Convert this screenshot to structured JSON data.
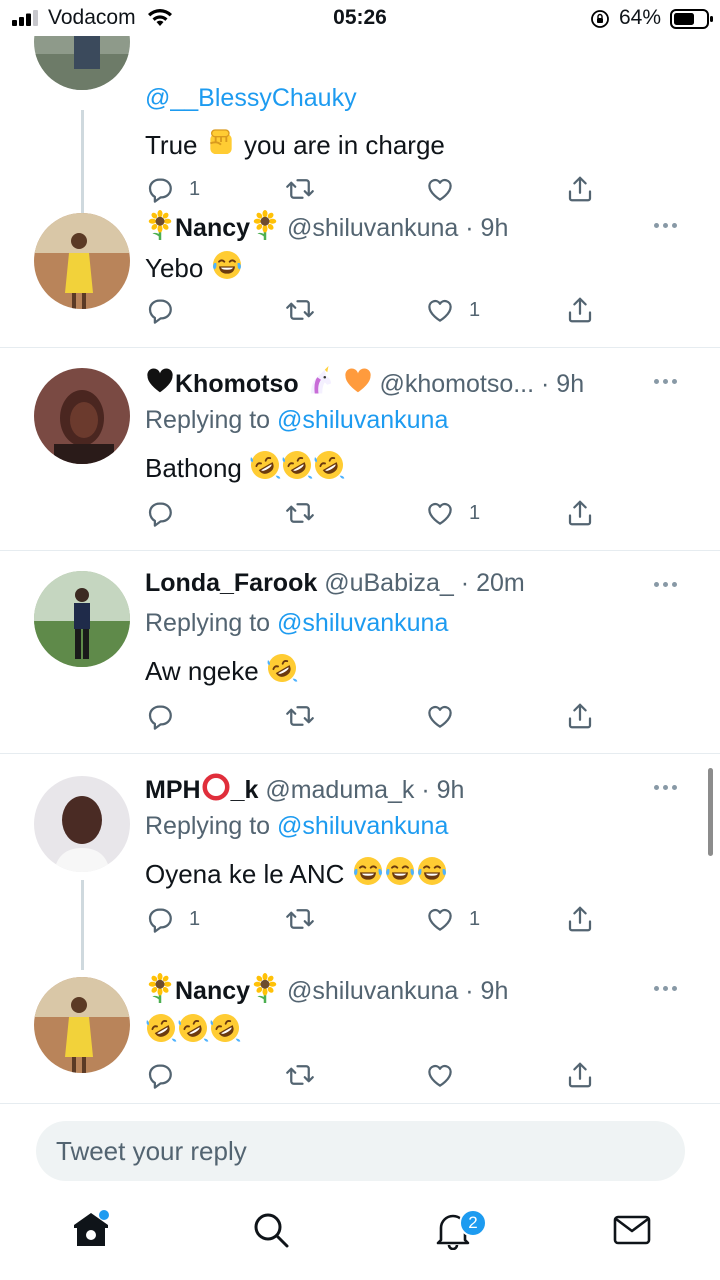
{
  "status_bar": {
    "carrier": "Vodacom",
    "time": "05:26",
    "battery": "64%"
  },
  "tweets": [
    {
      "reply_to": "@__BlessyChauky",
      "text": "True",
      "text_after": "you are in charge",
      "text_emoji": "raised-fist",
      "reply_count": "1",
      "retweet_count": "",
      "like_count": ""
    },
    {
      "name": "Nancy",
      "name_emoji": "sunflower",
      "handle": "@shiluvankuna",
      "time": "· 9h",
      "text": "Yebo",
      "text_emojis": [
        "face-with-tears-of-joy"
      ],
      "reply_count": "",
      "retweet_count": "",
      "like_count": "1"
    },
    {
      "name": "Khomotso",
      "name_emojis": [
        "black-heart",
        "unicorn",
        "orange-heart"
      ],
      "handle": "@khomotso...",
      "time": "· 9h",
      "reply_label": "Replying to",
      "reply_to": "@shiluvankuna",
      "text": "Bathong",
      "text_emojis": [
        "rolling-on-floor-laughing",
        "rolling-on-floor-laughing",
        "rolling-on-floor-laughing"
      ],
      "reply_count": "",
      "retweet_count": "",
      "like_count": "1"
    },
    {
      "name": "Londa_Farook",
      "handle": "@uBabiza_",
      "time": "· 20m",
      "reply_label": "Replying to",
      "reply_to": "@shiluvankuna",
      "text": "Aw ngeke",
      "text_emojis": [
        "rolling-on-floor-laughing"
      ],
      "reply_count": "",
      "retweet_count": "",
      "like_count": ""
    },
    {
      "name_prefix": "MPH",
      "name_suffix": "_k",
      "name_emoji": "hollow-red-circle",
      "handle": "@maduma_k",
      "time": "· 9h",
      "reply_label": "Replying to",
      "reply_to": "@shiluvankuna",
      "text": "Oyena ke le ANC",
      "text_emojis": [
        "face-with-tears-of-joy",
        "face-with-tears-of-joy",
        "face-with-tears-of-joy"
      ],
      "reply_count": "1",
      "retweet_count": "",
      "like_count": "1"
    },
    {
      "name": "Nancy",
      "name_emoji": "sunflower",
      "handle": "@shiluvankuna",
      "time": "· 9h",
      "text_emojis": [
        "rolling-on-floor-laughing",
        "rolling-on-floor-laughing",
        "rolling-on-floor-laughing"
      ],
      "reply_count": "",
      "retweet_count": "",
      "like_count": ""
    }
  ],
  "reply_box": {
    "placeholder": "Tweet your reply"
  },
  "nav": {
    "notification_badge": "2",
    "items": [
      "home-icon",
      "search-icon",
      "notifications-icon",
      "messages-icon"
    ]
  },
  "colors": {
    "accent": "#1d9bf0",
    "text": "#0f1419",
    "secondary_text": "#536471",
    "divider": "#e6ecf0"
  }
}
